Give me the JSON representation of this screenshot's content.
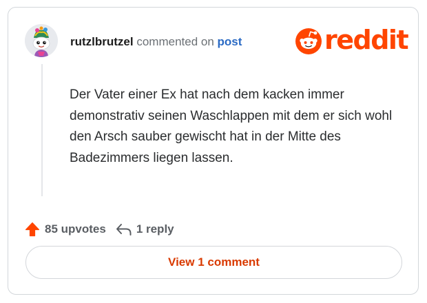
{
  "comment": {
    "username": "rutzlbrutzel",
    "action_text": "commented on",
    "target_link": "post",
    "body": "Der Vater einer Ex hat nach dem kacken immer demonstrativ seinen Waschlappen mit dem er sich wohl den Arsch sauber gewischt hat in der Mitte des Badezimmers liegen lassen.",
    "upvotes_text": "85 upvotes",
    "replies_text": "1 reply",
    "view_button": "View 1 comment"
  },
  "brand": {
    "logo_text": "reddit",
    "accent_color": "#ff4500",
    "link_color": "#2a6ac4"
  },
  "icons": {
    "avatar": "snoo-avatar-icon",
    "logo": "reddit-snoo-icon",
    "upvote": "upvote-arrow-icon",
    "reply": "reply-arrow-icon"
  }
}
